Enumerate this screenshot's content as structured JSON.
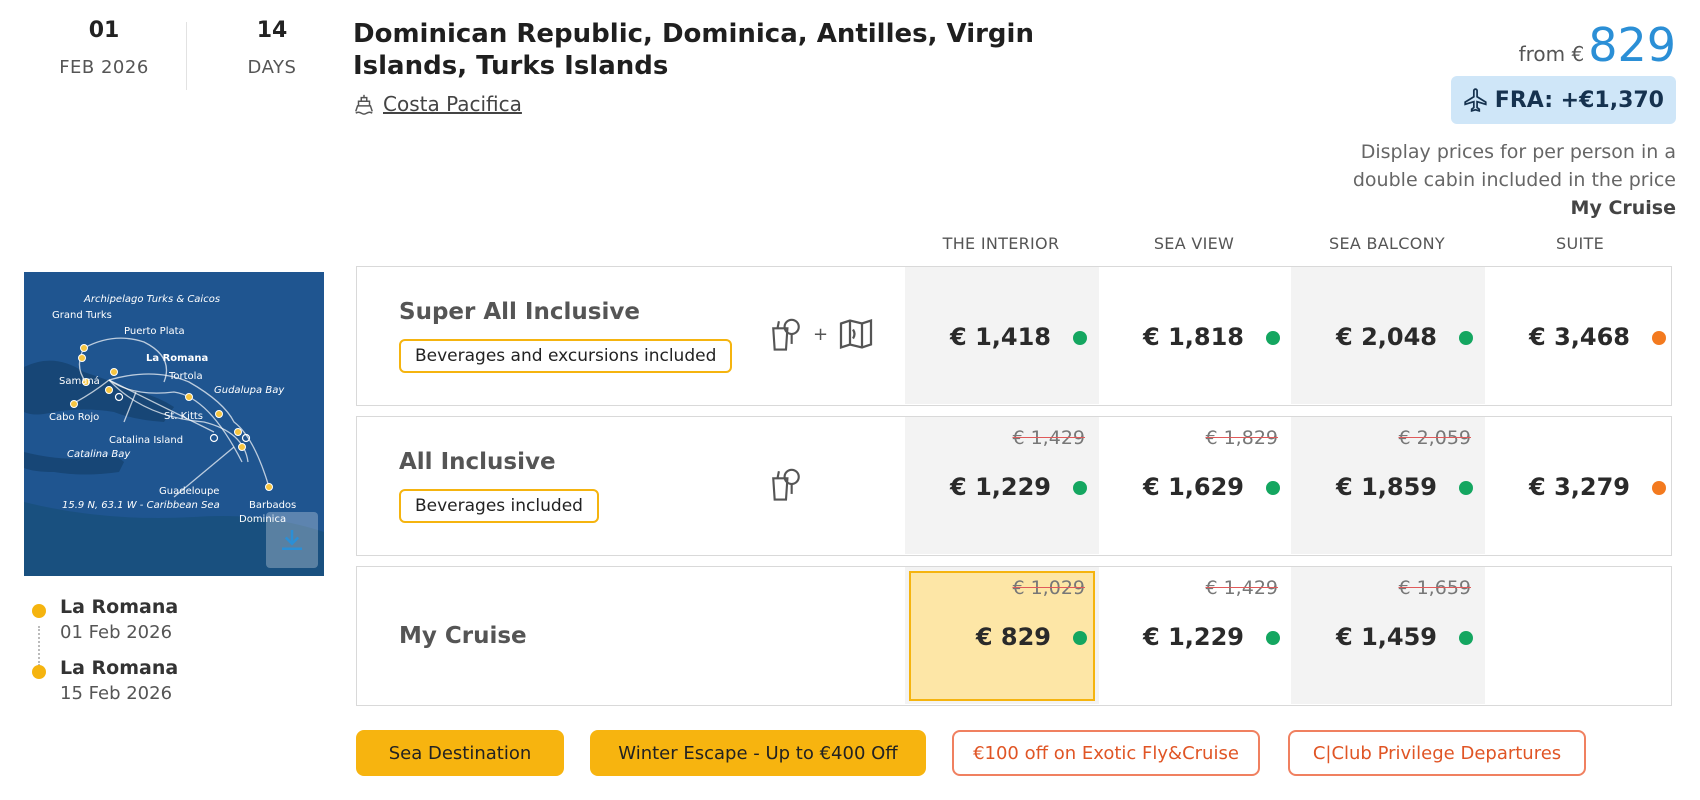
{
  "departure": {
    "day": "01",
    "month_year": "FEB 2026"
  },
  "duration": {
    "value": "14",
    "unit": "DAYS"
  },
  "cruise_title": "Dominican Republic, Dominica, Antilles, Virgin Islands, Turks Islands",
  "ship_name": "Costa Pacifica",
  "from_price": {
    "label": "from €",
    "value": "829"
  },
  "flight_supplement": "FRA: +€1,370",
  "price_note_line1": "Display prices for per person in a",
  "price_note_line2": "double cabin included in the price",
  "price_note_fare": "My Cruise",
  "cabin_columns": [
    "THE INTERIOR",
    "SEA VIEW",
    "SEA BALCONY",
    "SUITE"
  ],
  "map": {
    "labels": [
      "Archipelago Turks & Caicos",
      "Grand Turks",
      "Puerto Plata",
      "La Romana",
      "Samaná",
      "Tortola",
      "Gudalupa Bay",
      "St. Kitts",
      "Cabo Rojo",
      "Catalina Island",
      "Catalina Bay",
      "Guadeloupe",
      "15.9 N, 63.1 W - Caribbean Sea",
      "Barbados",
      "Dominica"
    ]
  },
  "itinerary": [
    {
      "port": "La Romana",
      "date": "01 Feb 2026"
    },
    {
      "port": "La Romana",
      "date": "15 Feb 2026"
    }
  ],
  "fares": [
    {
      "name": "Super All Inclusive",
      "tag": "Beverages and excursions included",
      "icons": [
        "drinks-icon",
        "plus",
        "map-icon"
      ],
      "prices": [
        {
          "price": "€ 1,418",
          "old": "",
          "status": "green"
        },
        {
          "price": "€ 1,818",
          "old": "",
          "status": "green"
        },
        {
          "price": "€ 2,048",
          "old": "",
          "status": "green"
        },
        {
          "price": "€ 3,468",
          "old": "",
          "status": "orange"
        }
      ]
    },
    {
      "name": "All Inclusive",
      "tag": "Beverages included",
      "icons": [
        "drinks-icon"
      ],
      "prices": [
        {
          "price": "€ 1,229",
          "old": "€ 1,429",
          "status": "green"
        },
        {
          "price": "€ 1,629",
          "old": "€ 1,829",
          "status": "green"
        },
        {
          "price": "€ 1,859",
          "old": "€ 2,059",
          "status": "green"
        },
        {
          "price": "€ 3,279",
          "old": "",
          "status": "orange"
        }
      ]
    },
    {
      "name": "My Cruise",
      "tag": "",
      "icons": [],
      "prices": [
        {
          "price": "€ 829",
          "old": "€ 1,029",
          "status": "green",
          "selected": true
        },
        {
          "price": "€ 1,229",
          "old": "€ 1,429",
          "status": "green"
        },
        {
          "price": "€ 1,459",
          "old": "€ 1,659",
          "status": "green"
        },
        {
          "price": "",
          "old": "",
          "status": ""
        }
      ]
    }
  ],
  "promotions": [
    "Sea Destination",
    "Winter Escape - Up to €400 Off",
    "€100 off on Exotic Fly&Cruise",
    "C|Club Privilege Departures"
  ],
  "colors": {
    "accent_blue": "#2b8fd6",
    "tag_yellow": "#f5b40f",
    "available_green": "#14a660",
    "limited_orange": "#f37a1f",
    "promo_red": "#e05525"
  }
}
